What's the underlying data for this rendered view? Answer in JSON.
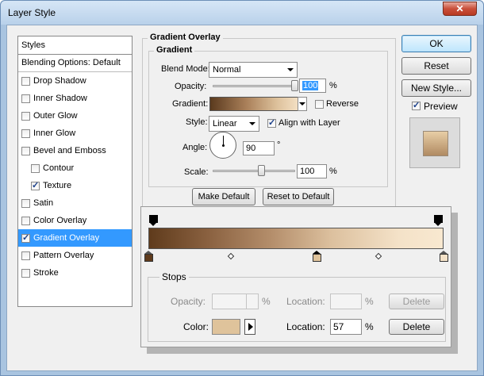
{
  "window": {
    "title": "Layer Style",
    "close_label": "✕"
  },
  "styles_panel": {
    "header": "Styles",
    "blending_options": "Blending Options: Default",
    "items": [
      {
        "label": "Drop Shadow",
        "checked": false,
        "indent": false
      },
      {
        "label": "Inner Shadow",
        "checked": false,
        "indent": false
      },
      {
        "label": "Outer Glow",
        "checked": false,
        "indent": false
      },
      {
        "label": "Inner Glow",
        "checked": false,
        "indent": false
      },
      {
        "label": "Bevel and Emboss",
        "checked": false,
        "indent": false
      },
      {
        "label": "Contour",
        "checked": false,
        "indent": true
      },
      {
        "label": "Texture",
        "checked": true,
        "indent": true
      },
      {
        "label": "Satin",
        "checked": false,
        "indent": false
      },
      {
        "label": "Color Overlay",
        "checked": false,
        "indent": false
      },
      {
        "label": "Gradient Overlay",
        "checked": true,
        "indent": false,
        "selected": true
      },
      {
        "label": "Pattern Overlay",
        "checked": false,
        "indent": false
      },
      {
        "label": "Stroke",
        "checked": false,
        "indent": false
      }
    ]
  },
  "gradient_overlay": {
    "section_title": "Gradient Overlay",
    "group_title": "Gradient",
    "blend_mode_label": "Blend Mode:",
    "blend_mode_value": "Normal",
    "opacity_label": "Opacity:",
    "opacity_value": "100",
    "opacity_unit": "%",
    "opacity_level": 1.0,
    "gradient_label": "Gradient:",
    "reverse_label": "Reverse",
    "reverse_checked": false,
    "style_label": "Style:",
    "style_value": "Linear",
    "align_label": "Align with Layer",
    "align_checked": true,
    "angle_label": "Angle:",
    "angle_value": "90",
    "angle_unit": "°",
    "scale_label": "Scale:",
    "scale_value": "100",
    "scale_unit": "%",
    "scale_level": 0.6,
    "make_default": "Make Default",
    "reset_default": "Reset to Default"
  },
  "buttons": {
    "ok": "OK",
    "reset": "Reset",
    "new_style": "New Style...",
    "preview_label": "Preview",
    "preview_checked": true
  },
  "gradient_editor": {
    "stops_title": "Stops",
    "opacity_label": "Opacity:",
    "opacity_unit": "%",
    "location_label_top": "Location:",
    "location_unit_top": "%",
    "delete_top": "Delete",
    "color_label": "Color:",
    "color_value": "#dfc39b",
    "location_label": "Location:",
    "location_value": "57",
    "location_unit": "%",
    "delete_bottom": "Delete",
    "color_stops": [
      {
        "location": 0,
        "color": "#5f3b1c"
      },
      {
        "location": 57,
        "color": "#dfc39b",
        "active": true
      },
      {
        "location": 100,
        "color": "#f4e2c8"
      }
    ],
    "midpoints": [
      28,
      78
    ],
    "opacity_stops": [
      0,
      100
    ]
  },
  "colors": {
    "selection": "#3399ff",
    "title_gradient_top": "#d6e6f6",
    "close_red": "#c94f3a"
  }
}
